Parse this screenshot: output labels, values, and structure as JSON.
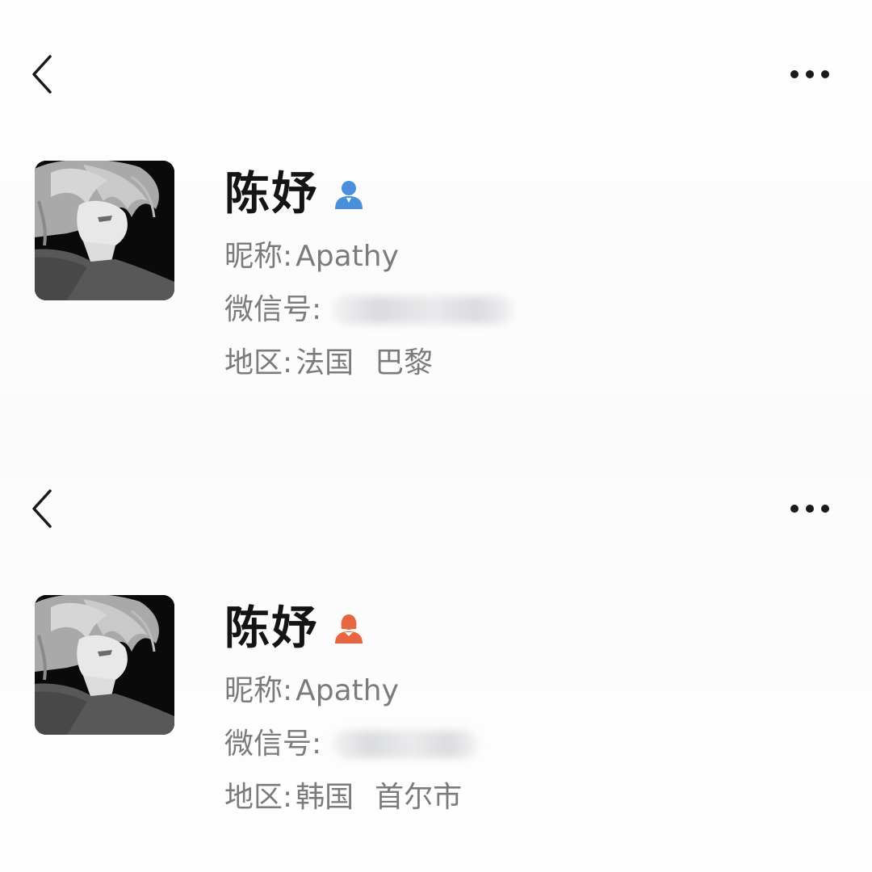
{
  "profiles": [
    {
      "name": "陈妤",
      "gender_icon": "male-user-icon",
      "gender_color": "#4a8fdd",
      "nickname_label": "昵称:",
      "nickname_value": "Apathy",
      "wechat_id_label": "微信号:",
      "region_label": "地区:",
      "region_country": "法国",
      "region_city": "巴黎"
    },
    {
      "name": "陈妤",
      "gender_icon": "female-user-icon",
      "gender_color": "#e8653f",
      "nickname_label": "昵称:",
      "nickname_value": "Apathy",
      "wechat_id_label": "微信号:",
      "region_label": "地区:",
      "region_country": "韩国",
      "region_city": "首尔市"
    }
  ],
  "icons": {
    "back": "chevron-left-icon",
    "more": "more-dots-icon",
    "avatar": "anime-boy-avatar"
  }
}
